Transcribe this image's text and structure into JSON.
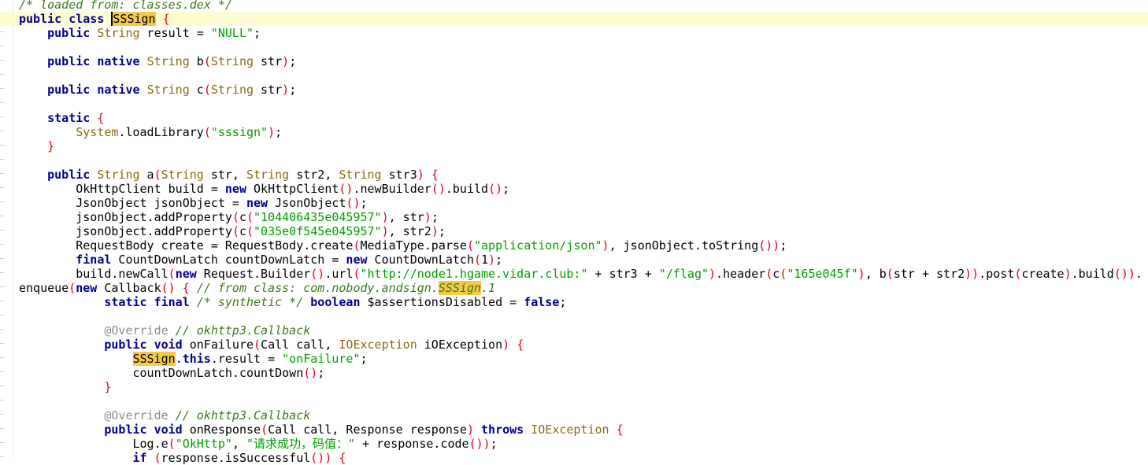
{
  "editor": {
    "lines": [
      {
        "indent": 0,
        "highlight": false,
        "tokens": [
          {
            "t": "/* loaded from: classes.dex */",
            "c": "cmt"
          }
        ]
      },
      {
        "indent": 0,
        "highlight": true,
        "tokens": [
          {
            "t": "public",
            "c": "kw"
          },
          {
            "t": " "
          },
          {
            "t": "class",
            "c": "kw"
          },
          {
            "t": " "
          },
          {
            "t": "SSSign",
            "c": "hit",
            "caret": true
          },
          {
            "t": " "
          },
          {
            "t": "{",
            "c": "p"
          }
        ]
      },
      {
        "indent": 4,
        "highlight": false,
        "tokens": [
          {
            "t": "public",
            "c": "kw"
          },
          {
            "t": " "
          },
          {
            "t": "String",
            "c": "tp"
          },
          {
            "t": " result = "
          },
          {
            "t": "\"NULL\"",
            "c": "str"
          },
          {
            "t": ";"
          }
        ]
      },
      {
        "indent": 0,
        "highlight": false,
        "tokens": []
      },
      {
        "indent": 4,
        "highlight": false,
        "tokens": [
          {
            "t": "public",
            "c": "kw"
          },
          {
            "t": " "
          },
          {
            "t": "native",
            "c": "kw"
          },
          {
            "t": " "
          },
          {
            "t": "String",
            "c": "tp"
          },
          {
            "t": " b"
          },
          {
            "t": "(",
            "c": "p"
          },
          {
            "t": "String",
            "c": "tp"
          },
          {
            "t": " str"
          },
          {
            "t": ")",
            "c": "p"
          },
          {
            "t": ";"
          }
        ]
      },
      {
        "indent": 0,
        "highlight": false,
        "tokens": []
      },
      {
        "indent": 4,
        "highlight": false,
        "tokens": [
          {
            "t": "public",
            "c": "kw"
          },
          {
            "t": " "
          },
          {
            "t": "native",
            "c": "kw"
          },
          {
            "t": " "
          },
          {
            "t": "String",
            "c": "tp"
          },
          {
            "t": " c"
          },
          {
            "t": "(",
            "c": "p"
          },
          {
            "t": "String",
            "c": "tp"
          },
          {
            "t": " str"
          },
          {
            "t": ")",
            "c": "p"
          },
          {
            "t": ";"
          }
        ]
      },
      {
        "indent": 0,
        "highlight": false,
        "tokens": []
      },
      {
        "indent": 4,
        "highlight": false,
        "tokens": [
          {
            "t": "static",
            "c": "kw"
          },
          {
            "t": " "
          },
          {
            "t": "{",
            "c": "p"
          }
        ]
      },
      {
        "indent": 8,
        "highlight": false,
        "tokens": [
          {
            "t": "System",
            "c": "tp"
          },
          {
            "t": ".loadLibrary"
          },
          {
            "t": "(",
            "c": "p"
          },
          {
            "t": "\"sssign\"",
            "c": "str"
          },
          {
            "t": ")",
            "c": "p"
          },
          {
            "t": ";"
          }
        ]
      },
      {
        "indent": 4,
        "highlight": false,
        "tokens": [
          {
            "t": "}",
            "c": "p"
          }
        ]
      },
      {
        "indent": 0,
        "highlight": false,
        "tokens": []
      },
      {
        "indent": 4,
        "highlight": false,
        "tokens": [
          {
            "t": "public",
            "c": "kw"
          },
          {
            "t": " "
          },
          {
            "t": "String",
            "c": "tp"
          },
          {
            "t": " a"
          },
          {
            "t": "(",
            "c": "p"
          },
          {
            "t": "String",
            "c": "tp"
          },
          {
            "t": " str, "
          },
          {
            "t": "String",
            "c": "tp"
          },
          {
            "t": " str2, "
          },
          {
            "t": "String",
            "c": "tp"
          },
          {
            "t": " str3"
          },
          {
            "t": ")",
            "c": "p"
          },
          {
            "t": " "
          },
          {
            "t": "{",
            "c": "p"
          }
        ]
      },
      {
        "indent": 8,
        "highlight": false,
        "tokens": [
          {
            "t": "OkHttpClient build = "
          },
          {
            "t": "new",
            "c": "kw"
          },
          {
            "t": " OkHttpClient"
          },
          {
            "t": "()",
            "c": "p"
          },
          {
            "t": ".newBuilder"
          },
          {
            "t": "()",
            "c": "p"
          },
          {
            "t": ".build"
          },
          {
            "t": "()",
            "c": "p"
          },
          {
            "t": ";"
          }
        ]
      },
      {
        "indent": 8,
        "highlight": false,
        "tokens": [
          {
            "t": "JsonObject jsonObject = "
          },
          {
            "t": "new",
            "c": "kw"
          },
          {
            "t": " JsonObject"
          },
          {
            "t": "()",
            "c": "p"
          },
          {
            "t": ";"
          }
        ]
      },
      {
        "indent": 8,
        "highlight": false,
        "tokens": [
          {
            "t": "jsonObject.addProperty"
          },
          {
            "t": "(",
            "c": "p"
          },
          {
            "t": "c"
          },
          {
            "t": "(",
            "c": "p"
          },
          {
            "t": "\"104406435e045957\"",
            "c": "str"
          },
          {
            "t": ")",
            "c": "p"
          },
          {
            "t": ", str"
          },
          {
            "t": ")",
            "c": "p"
          },
          {
            "t": ";"
          }
        ]
      },
      {
        "indent": 8,
        "highlight": false,
        "tokens": [
          {
            "t": "jsonObject.addProperty"
          },
          {
            "t": "(",
            "c": "p"
          },
          {
            "t": "c"
          },
          {
            "t": "(",
            "c": "p"
          },
          {
            "t": "\"035e0f545e045957\"",
            "c": "str"
          },
          {
            "t": ")",
            "c": "p"
          },
          {
            "t": ", str2"
          },
          {
            "t": ")",
            "c": "p"
          },
          {
            "t": ";"
          }
        ]
      },
      {
        "indent": 8,
        "highlight": false,
        "tokens": [
          {
            "t": "RequestBody create = RequestBody.create"
          },
          {
            "t": "(",
            "c": "p"
          },
          {
            "t": "MediaType.parse"
          },
          {
            "t": "(",
            "c": "p"
          },
          {
            "t": "\"application/json\"",
            "c": "str"
          },
          {
            "t": ")",
            "c": "p"
          },
          {
            "t": ", jsonObject.toString"
          },
          {
            "t": "())",
            "c": "p"
          },
          {
            "t": ";"
          }
        ]
      },
      {
        "indent": 8,
        "highlight": false,
        "tokens": [
          {
            "t": "final",
            "c": "kw"
          },
          {
            "t": " CountDownLatch countDownLatch = "
          },
          {
            "t": "new",
            "c": "kw"
          },
          {
            "t": " CountDownLatch"
          },
          {
            "t": "(",
            "c": "p"
          },
          {
            "t": "1"
          },
          {
            "t": ")",
            "c": "p"
          },
          {
            "t": ";"
          }
        ]
      },
      {
        "indent": 8,
        "highlight": false,
        "tokens": [
          {
            "t": "build.newCall"
          },
          {
            "t": "(",
            "c": "p"
          },
          {
            "t": "new",
            "c": "kw"
          },
          {
            "t": " Request.Builder"
          },
          {
            "t": "()",
            "c": "p"
          },
          {
            "t": ".url"
          },
          {
            "t": "(",
            "c": "p"
          },
          {
            "t": "\"http://node1.hgame.vidar.club:\"",
            "c": "str"
          },
          {
            "t": " + str3 + "
          },
          {
            "t": "\"/flag\"",
            "c": "str"
          },
          {
            "t": ")",
            "c": "p"
          },
          {
            "t": ".header"
          },
          {
            "t": "(",
            "c": "p"
          },
          {
            "t": "c"
          },
          {
            "t": "(",
            "c": "p"
          },
          {
            "t": "\"165e045f\"",
            "c": "str"
          },
          {
            "t": ")",
            "c": "p"
          },
          {
            "t": ", b"
          },
          {
            "t": "(",
            "c": "p"
          },
          {
            "t": "str + str2"
          },
          {
            "t": "))",
            "c": "p"
          },
          {
            "t": ".post"
          },
          {
            "t": "(",
            "c": "p"
          },
          {
            "t": "create"
          },
          {
            "t": ")",
            "c": "p"
          },
          {
            "t": ".build"
          },
          {
            "t": "())",
            "c": "p"
          },
          {
            "t": "."
          }
        ]
      },
      {
        "indent": 0,
        "highlight": false,
        "tokens": [
          {
            "t": "enqueue"
          },
          {
            "t": "(",
            "c": "p"
          },
          {
            "t": "new",
            "c": "kw"
          },
          {
            "t": " Callback"
          },
          {
            "t": "()",
            "c": "p"
          },
          {
            "t": " "
          },
          {
            "t": "{",
            "c": "p"
          },
          {
            "t": " "
          },
          {
            "t": "// from class: com.nobody.andsign.",
            "c": "cmt"
          },
          {
            "t": "SSSign",
            "c": "cmt hit"
          },
          {
            "t": ".1",
            "c": "cmt"
          }
        ]
      },
      {
        "indent": 12,
        "highlight": false,
        "tokens": [
          {
            "t": "static",
            "c": "kw"
          },
          {
            "t": " "
          },
          {
            "t": "final",
            "c": "kw"
          },
          {
            "t": " "
          },
          {
            "t": "/* synthetic */",
            "c": "cmt"
          },
          {
            "t": " "
          },
          {
            "t": "boolean",
            "c": "kw"
          },
          {
            "t": " $assertionsDisabled = "
          },
          {
            "t": "false",
            "c": "kw"
          },
          {
            "t": ";"
          }
        ]
      },
      {
        "indent": 0,
        "highlight": false,
        "tokens": []
      },
      {
        "indent": 12,
        "highlight": false,
        "tokens": [
          {
            "t": "@Override",
            "c": "ann"
          },
          {
            "t": " "
          },
          {
            "t": "// okhttp3.Callback",
            "c": "cmt"
          }
        ]
      },
      {
        "indent": 12,
        "highlight": false,
        "tokens": [
          {
            "t": "public",
            "c": "kw"
          },
          {
            "t": " "
          },
          {
            "t": "void",
            "c": "kw"
          },
          {
            "t": " onFailure"
          },
          {
            "t": "(",
            "c": "p"
          },
          {
            "t": "Call call, "
          },
          {
            "t": "IOException",
            "c": "tp"
          },
          {
            "t": " iOException"
          },
          {
            "t": ")",
            "c": "p"
          },
          {
            "t": " "
          },
          {
            "t": "{",
            "c": "p"
          }
        ]
      },
      {
        "indent": 16,
        "highlight": false,
        "tokens": [
          {
            "t": "SSSign",
            "c": "hit"
          },
          {
            "t": "."
          },
          {
            "t": "this",
            "c": "kw"
          },
          {
            "t": ".result = "
          },
          {
            "t": "\"onFailure\"",
            "c": "str"
          },
          {
            "t": ";"
          }
        ]
      },
      {
        "indent": 16,
        "highlight": false,
        "tokens": [
          {
            "t": "countDownLatch.countDown"
          },
          {
            "t": "()",
            "c": "p"
          },
          {
            "t": ";"
          }
        ]
      },
      {
        "indent": 12,
        "highlight": false,
        "tokens": [
          {
            "t": "}",
            "c": "p"
          }
        ]
      },
      {
        "indent": 0,
        "highlight": false,
        "tokens": []
      },
      {
        "indent": 12,
        "highlight": false,
        "tokens": [
          {
            "t": "@Override",
            "c": "ann"
          },
          {
            "t": " "
          },
          {
            "t": "// okhttp3.Callback",
            "c": "cmt"
          }
        ]
      },
      {
        "indent": 12,
        "highlight": false,
        "tokens": [
          {
            "t": "public",
            "c": "kw"
          },
          {
            "t": " "
          },
          {
            "t": "void",
            "c": "kw"
          },
          {
            "t": " onResponse"
          },
          {
            "t": "(",
            "c": "p"
          },
          {
            "t": "Call call, Response response"
          },
          {
            "t": ")",
            "c": "p"
          },
          {
            "t": " "
          },
          {
            "t": "throws",
            "c": "kw"
          },
          {
            "t": " "
          },
          {
            "t": "IOException",
            "c": "tp"
          },
          {
            "t": " "
          },
          {
            "t": "{",
            "c": "p"
          }
        ]
      },
      {
        "indent": 16,
        "highlight": false,
        "tokens": [
          {
            "t": "Log.e"
          },
          {
            "t": "(",
            "c": "p"
          },
          {
            "t": "\"OkHttp\"",
            "c": "str"
          },
          {
            "t": ", "
          },
          {
            "t": "\"请求成功，码值：\"",
            "c": "str"
          },
          {
            "t": " + response.code"
          },
          {
            "t": "())",
            "c": "p"
          },
          {
            "t": ";"
          }
        ]
      },
      {
        "indent": 16,
        "highlight": false,
        "tokens": [
          {
            "t": "if",
            "c": "kw"
          },
          {
            "t": " "
          },
          {
            "t": "(",
            "c": "p"
          },
          {
            "t": "response.isSuccessful"
          },
          {
            "t": "())",
            "c": "p"
          },
          {
            "t": " "
          },
          {
            "t": "{",
            "c": "p"
          }
        ]
      }
    ]
  }
}
